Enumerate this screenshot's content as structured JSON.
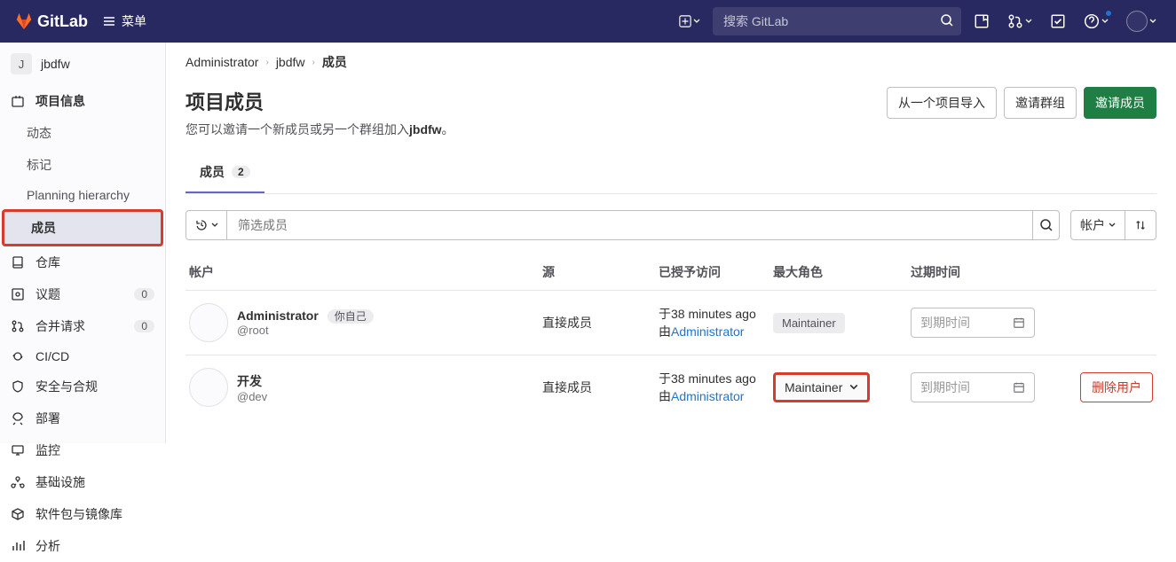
{
  "topbar": {
    "brand": "GitLab",
    "menu_label": "菜单",
    "search_placeholder": "搜索 GitLab"
  },
  "sidebar": {
    "project_letter": "J",
    "project_name": "jbdfw",
    "items": {
      "project_info": "项目信息",
      "activity": "动态",
      "labels": "标记",
      "planning": "Planning hierarchy",
      "members": "成员",
      "repository": "仓库",
      "issues": "议题",
      "issues_count": "0",
      "merge_requests": "合并请求",
      "merge_requests_count": "0",
      "cicd": "CI/CD",
      "security": "安全与合规",
      "deploy": "部署",
      "monitor": "监控",
      "infra": "基础设施",
      "packages": "软件包与镜像库",
      "analytics": "分析"
    }
  },
  "breadcrumb": {
    "admin": "Administrator",
    "project": "jbdfw",
    "current": "成员"
  },
  "header": {
    "title": "项目成员",
    "subtitle_prefix": "您可以邀请一个新成员或另一个群组加入",
    "subtitle_project": "jbdfw",
    "subtitle_suffix": "。",
    "btn_import": "从一个项目导入",
    "btn_invite_group": "邀请群组",
    "btn_invite_member": "邀请成员"
  },
  "tabs": {
    "members": "成员",
    "members_count": "2"
  },
  "filter": {
    "placeholder": "筛选成员",
    "sort_label": "帐户"
  },
  "table": {
    "h_account": "帐户",
    "h_source": "源",
    "h_access": "已授予访问",
    "h_role": "最大角色",
    "h_exp": "过期时间",
    "rows": [
      {
        "name": "Administrator",
        "you": "你自己",
        "username": "@root",
        "source": "直接成员",
        "access_time": "于38 minutes ago",
        "access_by_prefix": "由",
        "access_by": "Administrator",
        "role": "Maintainer",
        "exp_placeholder": "到期时间"
      },
      {
        "name": "开发",
        "username": "@dev",
        "source": "直接成员",
        "access_time": "于38 minutes ago",
        "access_by_prefix": "由",
        "access_by": "Administrator",
        "role": "Maintainer",
        "exp_placeholder": "到期时间",
        "remove": "删除用户"
      }
    ]
  }
}
